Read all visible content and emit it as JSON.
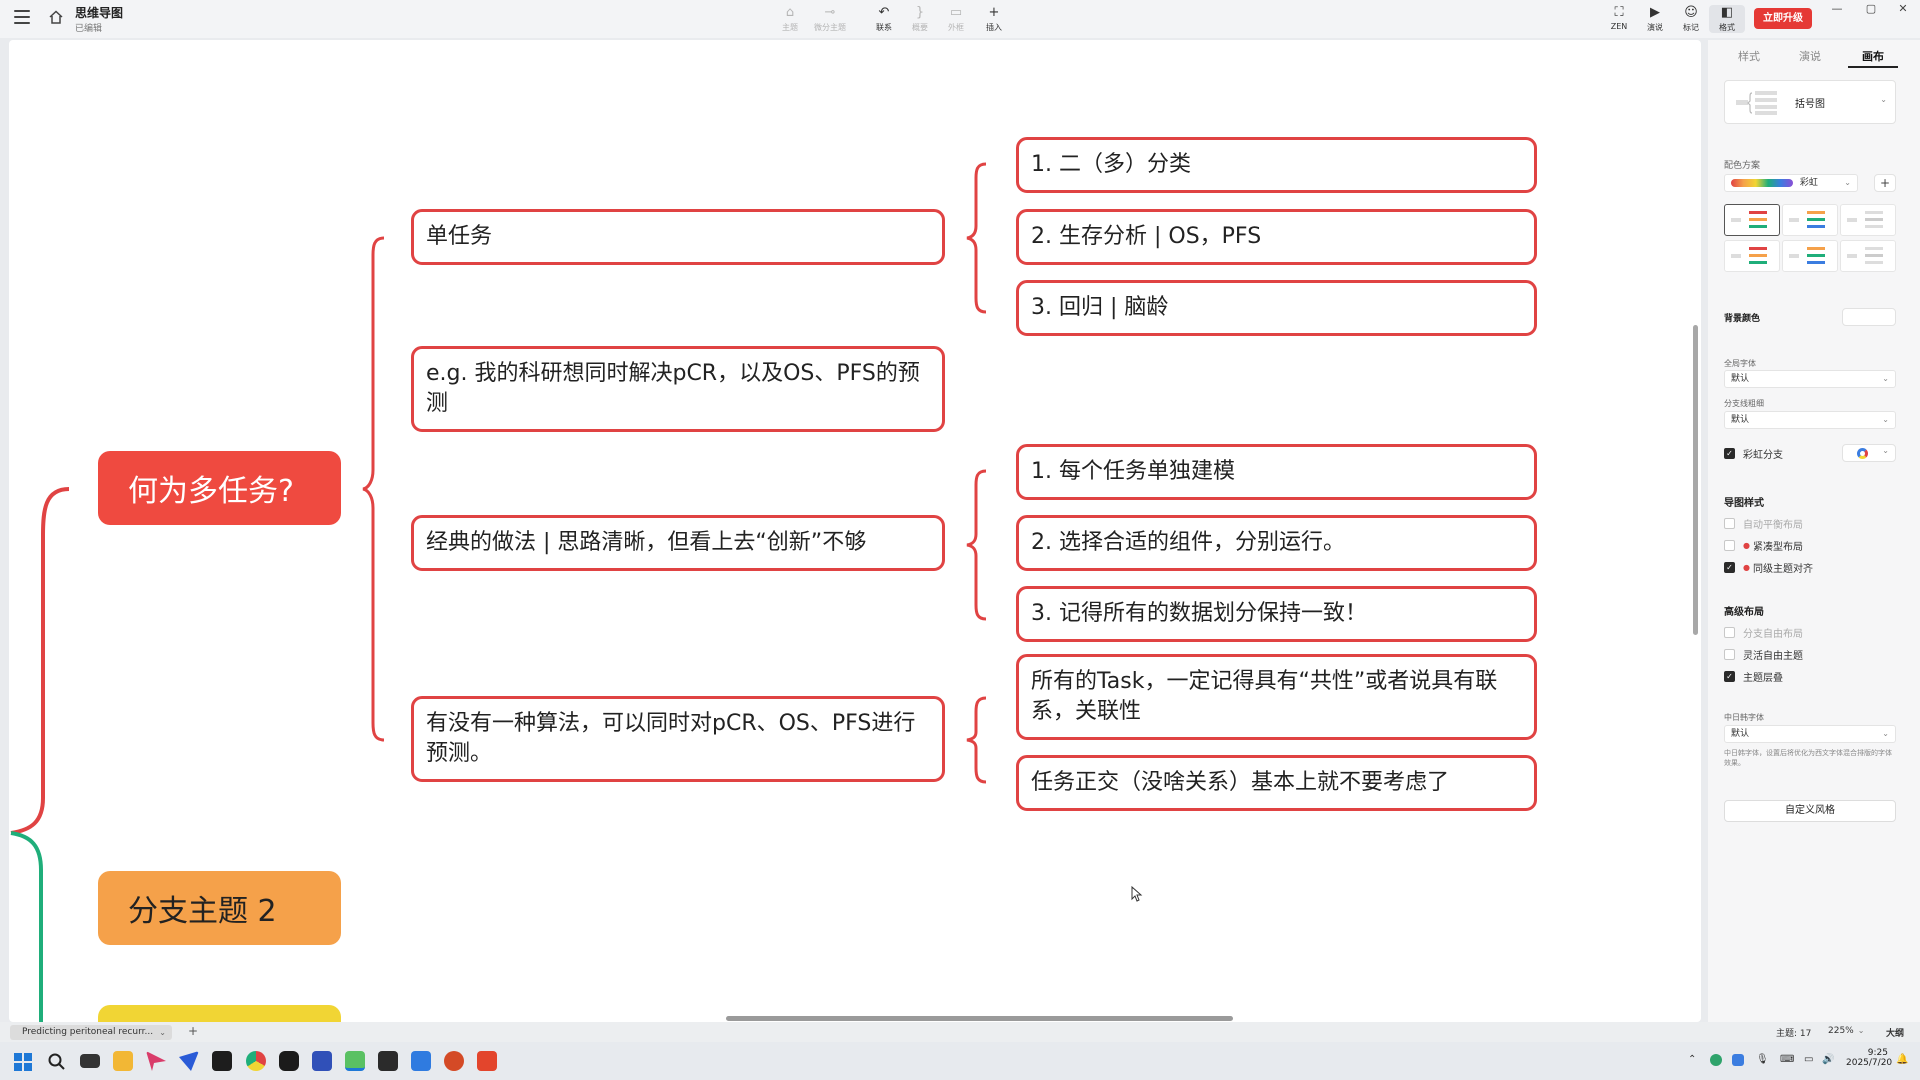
{
  "app": {
    "title": "思维导图",
    "status": "已编辑",
    "upgrade_label": "立即升级",
    "window_controls": [
      "—",
      "▢",
      "✕"
    ]
  },
  "toolbar": {
    "center": [
      {
        "label": "主题",
        "icon": "topic-icon",
        "glyph": "⌂",
        "enabled": false
      },
      {
        "label": "微分主题",
        "icon": "subtopic-icon",
        "glyph": "⊸",
        "enabled": false
      },
      {
        "label": "联系",
        "icon": "relation-icon",
        "glyph": "↶",
        "enabled": true
      },
      {
        "label": "概要",
        "icon": "summary-icon",
        "glyph": "}",
        "enabled": false
      },
      {
        "label": "外框",
        "icon": "boundary-icon",
        "glyph": "▭",
        "enabled": false
      },
      {
        "label": "插入",
        "icon": "insert-icon",
        "glyph": "+",
        "enabled": true
      }
    ],
    "right": [
      {
        "label": "ZEN",
        "icon": "zen-icon",
        "glyph": "⛶"
      },
      {
        "label": "演说",
        "icon": "present-icon",
        "glyph": "▶"
      },
      {
        "label": "标记",
        "icon": "marker-icon",
        "glyph": "☺"
      },
      {
        "label": "格式",
        "icon": "format-panel-icon",
        "glyph": "◧"
      }
    ]
  },
  "mindmap": {
    "topics": [
      {
        "label": "何为多任务?",
        "color": "#ef4a40",
        "children": [
          {
            "label": "单任务",
            "children": [
              "1. 二（多）分类",
              "2. 生存分析 | OS，PFS",
              "3. 回归 | 脑龄"
            ]
          },
          {
            "label": "e.g. 我的科研想同时解决pCR，以及OS、PFS的预测",
            "children": []
          },
          {
            "label": "经典的做法 | 思路清晰，但看上去“创新”不够",
            "children": [
              "1. 每个任务单独建模",
              "2. 选择合适的组件，分别运行。",
              "3. 记得所有的数据划分保持一致！"
            ]
          },
          {
            "label": "有没有一种算法，可以同时对pCR、OS、PFS进行预测。",
            "children": [
              "所有的Task，一定记得具有“共性”或者说具有联系，关联性",
              "任务正交（没啥关系）基本上就不要考虑了"
            ]
          }
        ]
      },
      {
        "label": "分支主题 2",
        "color": "#f5a14a"
      },
      {
        "label": "",
        "color": "#f1d534"
      }
    ],
    "branch_colors": {
      "red": "#e04343",
      "green": "#1fae7a"
    }
  },
  "panel": {
    "tabs": [
      "样式",
      "演说",
      "画布"
    ],
    "active_tab": "画布",
    "structure": "括号图",
    "color_scheme_label": "配色方案",
    "color_scheme_value": "彩虹",
    "background_label": "背景颜色",
    "global_font_label": "全局字体",
    "global_font_value": "默认",
    "branch_width_label": "分支线粗细",
    "branch_width_value": "默认",
    "rainbow_branch_label": "彩虹分支",
    "rainbow_branch_checked": true,
    "map_style_title": "导图样式",
    "map_style_options": [
      {
        "label": "自动平衡布局",
        "checked": false,
        "dim": true,
        "mark": false
      },
      {
        "label": "紧凑型布局",
        "checked": false,
        "dim": false,
        "mark": true
      },
      {
        "label": "同级主题对齐",
        "checked": true,
        "dim": false,
        "mark": true
      }
    ],
    "advanced_title": "高级布局",
    "advanced_options": [
      {
        "label": "分支自由布局",
        "checked": false,
        "dim": true
      },
      {
        "label": "灵活自由主题",
        "checked": false,
        "dim": false
      },
      {
        "label": "主题层叠",
        "checked": true,
        "dim": false
      }
    ],
    "cjk_font_label": "中日韩字体",
    "cjk_font_value": "默认",
    "cjk_font_note": "中日韩字体，设置后将优化为西文字体混合排版的字体效果。",
    "custom_style_label": "自定义风格"
  },
  "statusbar": {
    "sheet_tab": "Predicting peritoneal recurr...",
    "add_sheet": "+",
    "topic_count": "主题: 17",
    "zoom": "225%",
    "outline": "大纲"
  },
  "taskbar": {
    "time": "9:25",
    "date": "2025/7/20"
  }
}
